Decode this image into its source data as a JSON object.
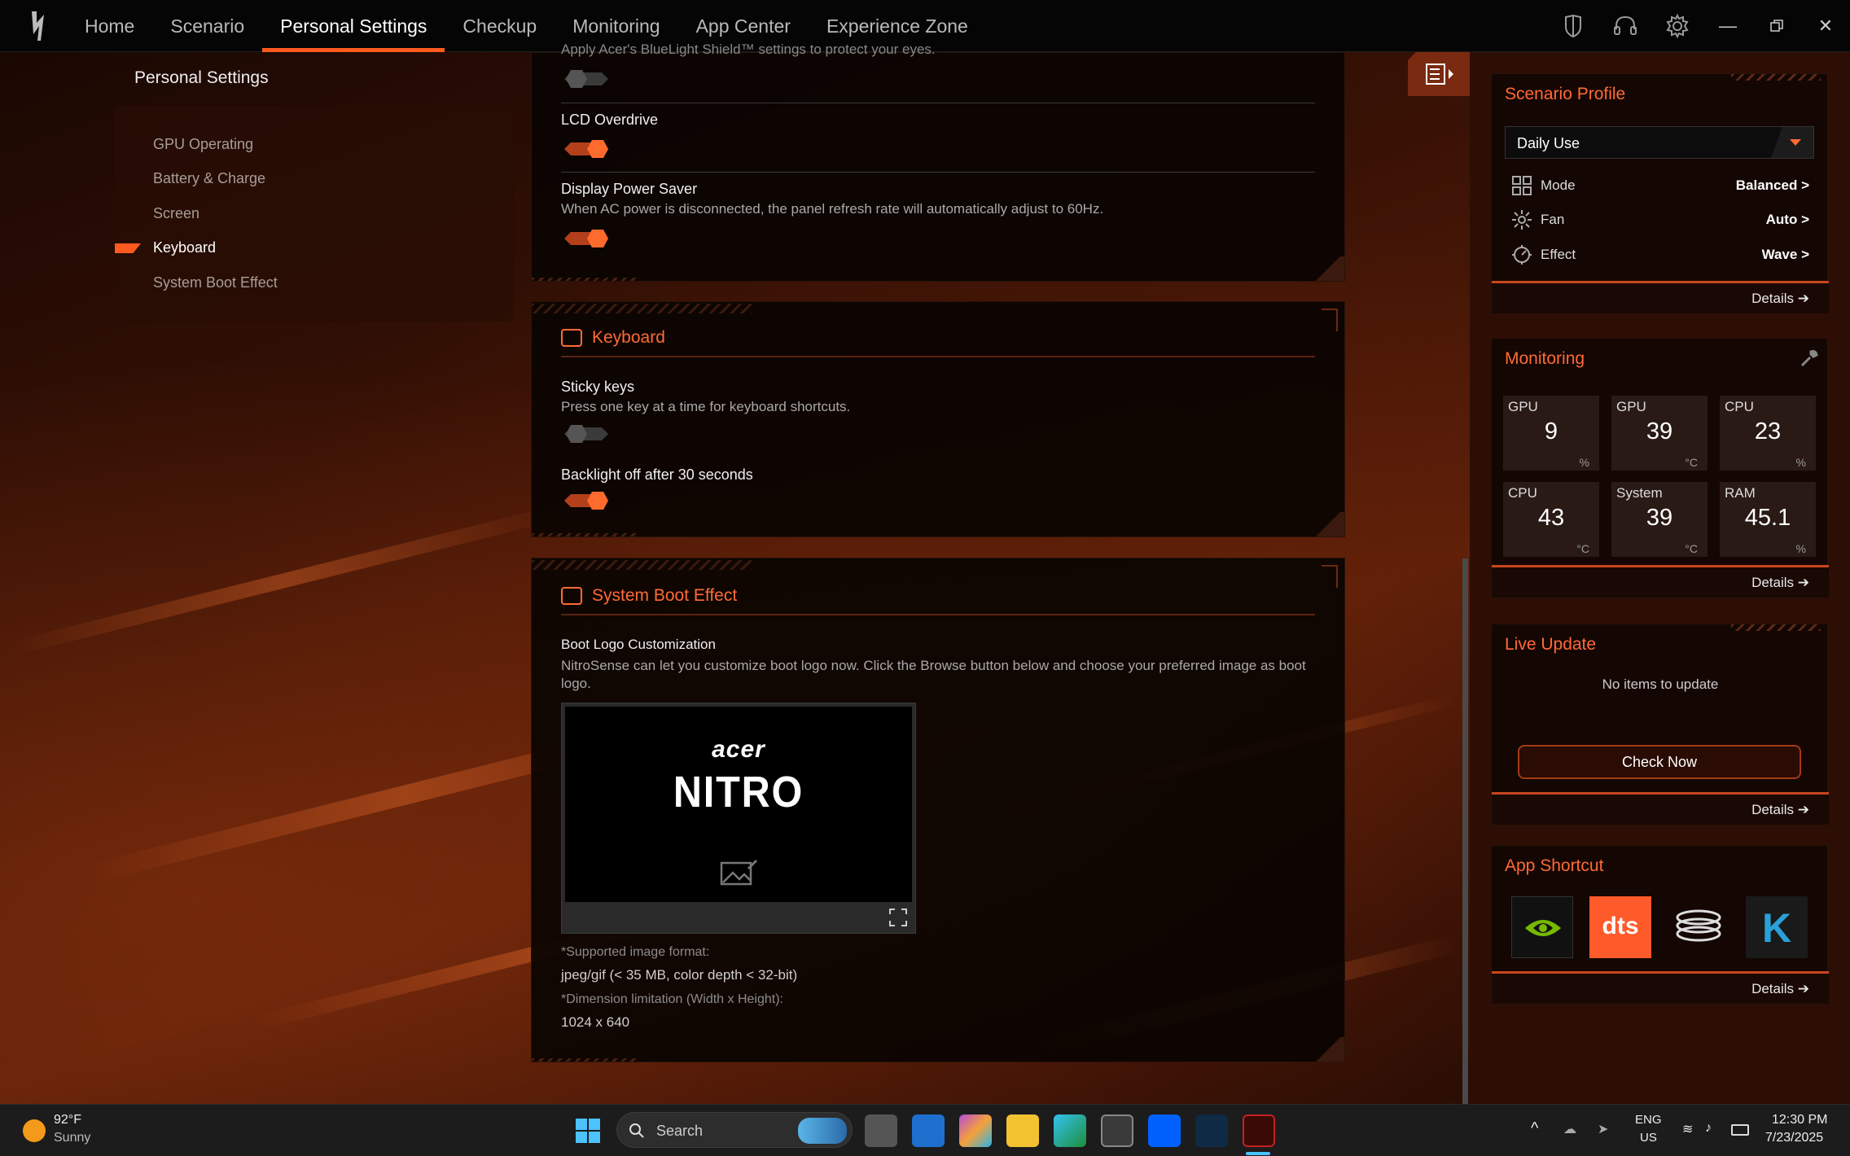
{
  "nav": {
    "items": [
      "Home",
      "Scenario",
      "Personal Settings",
      "Checkup",
      "Monitoring",
      "App Center",
      "Experience Zone"
    ],
    "active": "Personal Settings"
  },
  "left": {
    "title": "Personal Settings",
    "items": [
      "GPU Operating",
      "Battery & Charge",
      "Screen",
      "Keyboard",
      "System Boot Effect"
    ],
    "active": "Keyboard"
  },
  "screen": {
    "partial_text": "Apply Acer's BlueLight Shield™ settings to protect your eyes.",
    "lcd_label": "LCD Overdrive",
    "power_saver_label": "Display Power Saver",
    "power_saver_desc": "When AC power is disconnected, the panel refresh rate will automatically adjust to 60Hz.",
    "bluelight_on": false,
    "lcd_on": true,
    "power_saver_on": true
  },
  "keyboard": {
    "title": "Keyboard",
    "sticky_label": "Sticky keys",
    "sticky_desc": "Press one key at a time for keyboard shortcuts.",
    "sticky_on": false,
    "backlight_label": "Backlight off after 30 seconds",
    "backlight_on": true
  },
  "boot": {
    "title": "System Boot Effect",
    "logo_label": "Boot Logo Customization",
    "logo_desc": "NitroSense can let you customize boot logo now. Click the Browse button below and choose your preferred image as boot logo.",
    "preview_brand": "acer",
    "preview_product": "NITRO",
    "format_label": "*Supported image format:",
    "format_value": "jpeg/gif (< 35 MB, color depth < 32-bit)",
    "dim_label": "*Dimension limitation (Width x Height):",
    "dim_value": "1024 x 640"
  },
  "scenario": {
    "title": "Scenario Profile",
    "profile": "Daily Use",
    "rows": [
      {
        "icon": "mode-icon",
        "label": "Mode",
        "value": "Balanced"
      },
      {
        "icon": "fan-icon",
        "label": "Fan",
        "value": "Auto"
      },
      {
        "icon": "effect-icon",
        "label": "Effect",
        "value": "Wave"
      }
    ],
    "details": "Details"
  },
  "monitoring": {
    "title": "Monitoring",
    "tiles": [
      {
        "name": "GPU",
        "value": "9",
        "unit": "%"
      },
      {
        "name": "GPU",
        "value": "39",
        "unit": "°C"
      },
      {
        "name": "CPU",
        "value": "23",
        "unit": "%"
      },
      {
        "name": "CPU",
        "value": "43",
        "unit": "°C"
      },
      {
        "name": "System",
        "value": "39",
        "unit": "°C"
      },
      {
        "name": "RAM",
        "value": "45.1",
        "unit": "%"
      }
    ],
    "details": "Details"
  },
  "live_update": {
    "title": "Live Update",
    "message": "No items to update",
    "button": "Check Now",
    "details": "Details"
  },
  "shortcuts": {
    "title": "App Shortcut",
    "apps": [
      "nvidia-icon",
      "dts-icon",
      "audio-icon",
      "killer-icon"
    ],
    "dts_text": "dts",
    "killer_text": "K",
    "details": "Details"
  },
  "taskbar": {
    "temp": "92°F",
    "weather": "Sunny",
    "search": "Search",
    "lang1": "ENG",
    "lang2": "US",
    "time": "12:30 PM",
    "date": "7/23/2025"
  },
  "colors": {
    "accent": "#ff5a1f",
    "title_orange": "#ff6a35"
  }
}
